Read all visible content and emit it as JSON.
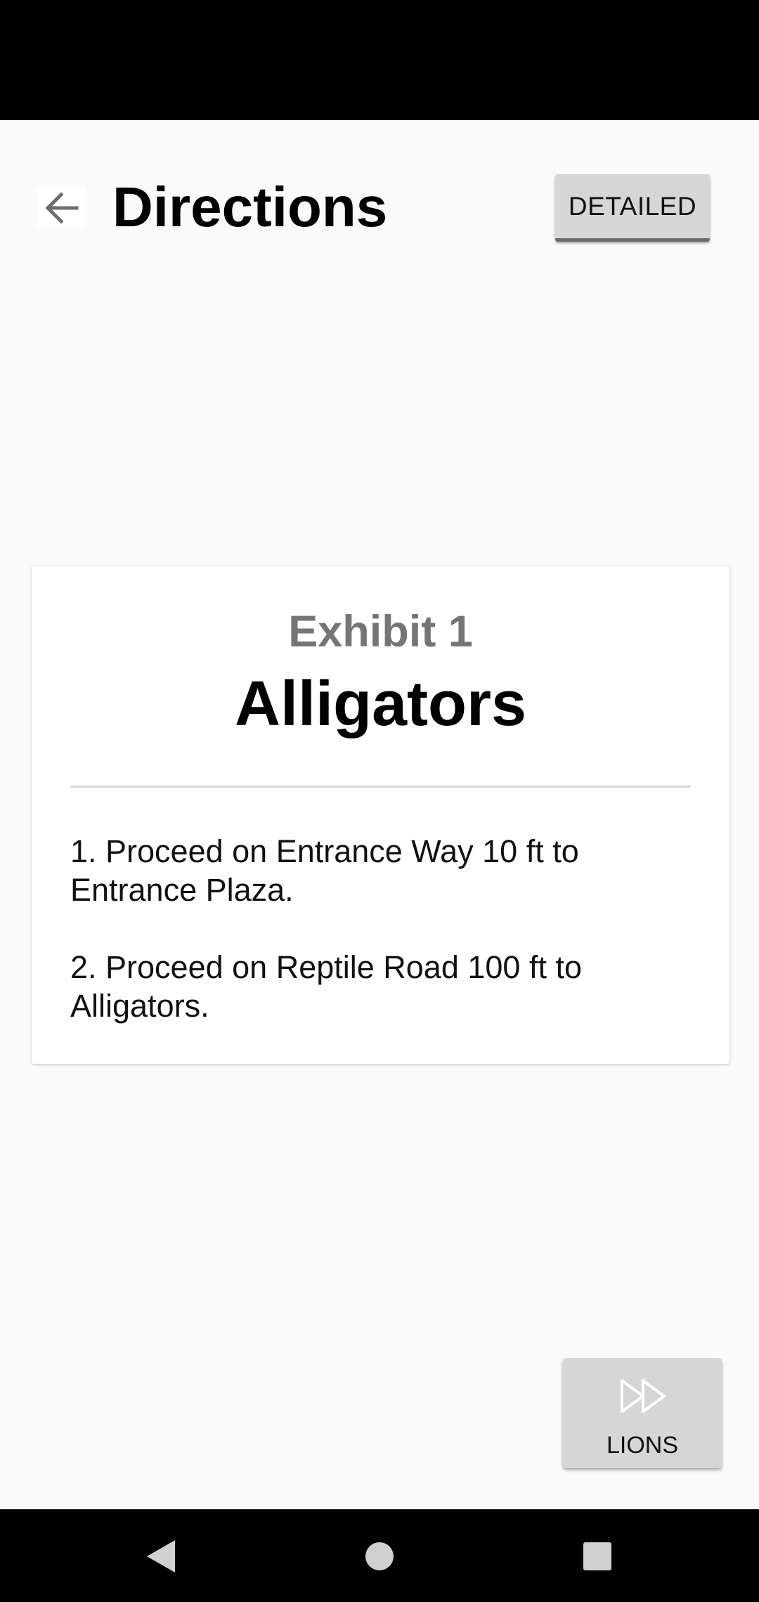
{
  "header": {
    "title": "Directions",
    "detailed_label": "DETAILED",
    "back_icon": "arrow-left-icon"
  },
  "card": {
    "subtitle": "Exhibit 1",
    "title": "Alligators",
    "steps": [
      "1. Proceed on Entrance Way 10 ft to Entrance Plaza.",
      "2. Proceed on Reptile Road 100 ft to Alligators."
    ]
  },
  "next_button": {
    "label": "LIONS",
    "icon": "fast-forward-icon"
  },
  "nav_bar": {
    "icons": [
      "nav-back-icon",
      "nav-home-icon",
      "nav-recents-icon"
    ]
  },
  "colors": {
    "background": "#fafafa",
    "button": "#d6d6d6",
    "subtitle": "#757575",
    "system_bars": "#000000"
  }
}
